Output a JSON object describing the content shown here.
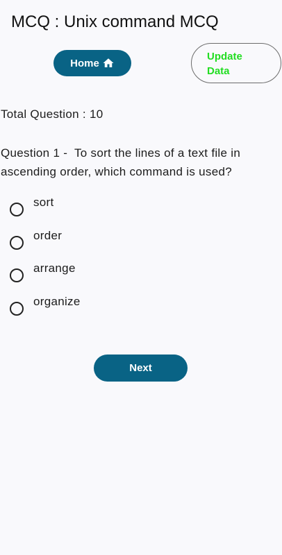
{
  "header": {
    "title": "MCQ : Unix command MCQ"
  },
  "buttons": {
    "home_label": "Home",
    "home_icon": "home-icon",
    "update_line1": "Update",
    "update_line2": "Data",
    "next_label": "Next"
  },
  "quiz": {
    "total_text": "Total Question : 10",
    "question_text": "Question 1 -  To sort the lines of a text file in ascending order, which command is used?",
    "options": [
      {
        "label": "sort",
        "selected": false
      },
      {
        "label": "order",
        "selected": false
      },
      {
        "label": "arrange",
        "selected": false
      },
      {
        "label": "organize",
        "selected": false
      }
    ]
  },
  "colors": {
    "background": "#f9f9fc",
    "primary_button": "#096385",
    "update_text": "#22dd22"
  }
}
